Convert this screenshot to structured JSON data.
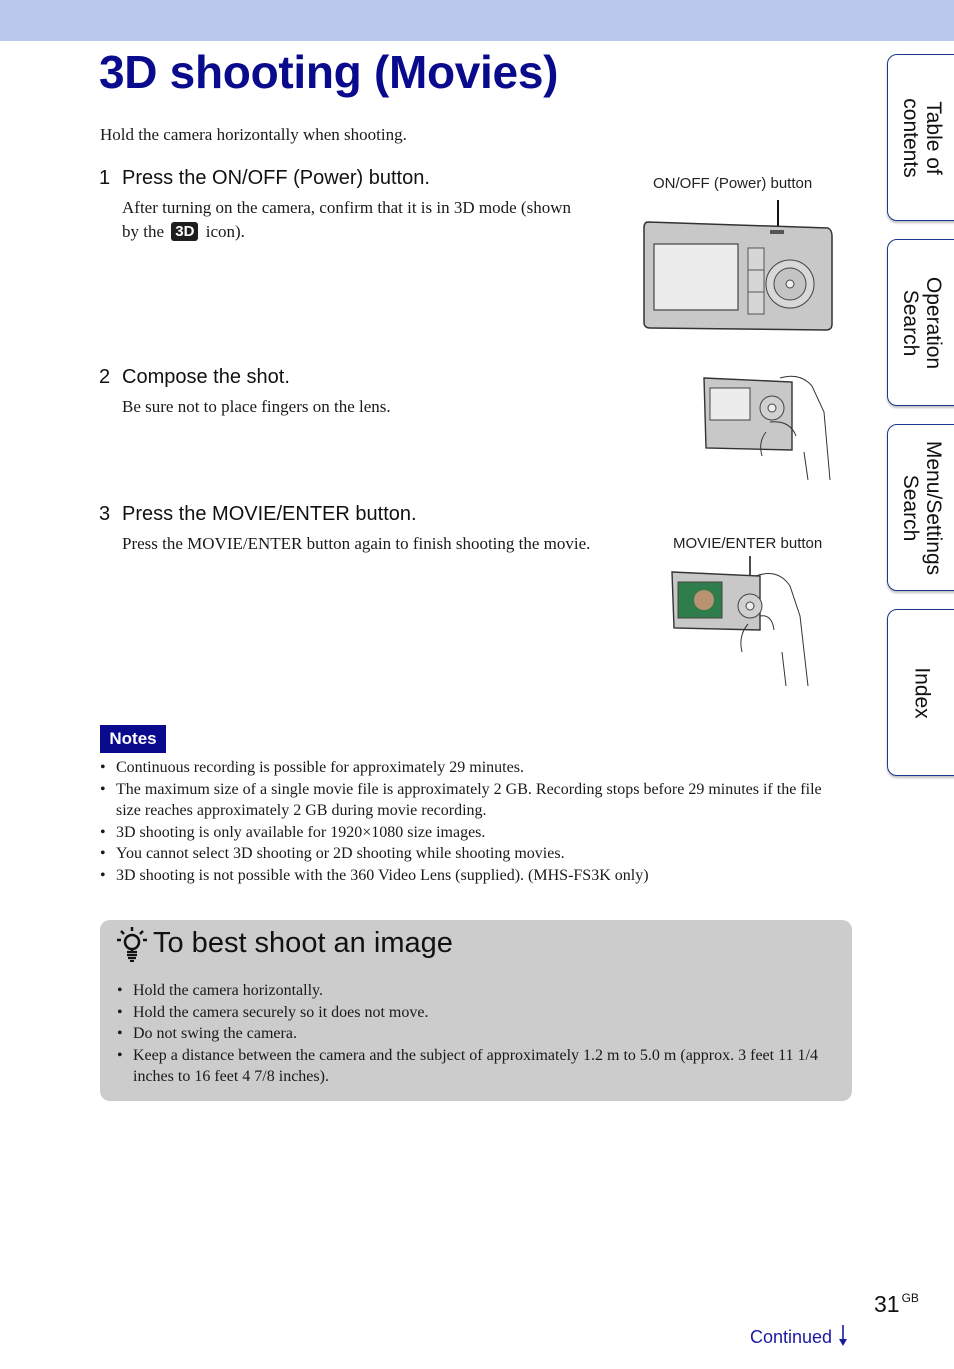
{
  "header": {
    "title": "3D shooting (Movies)"
  },
  "intro": "Hold the camera horizontally when shooting.",
  "steps": [
    {
      "num": "1",
      "heading": "Press the ON/OFF (Power) button.",
      "body_before": "After turning on the camera, confirm that it is in 3D mode (shown by the",
      "icon_label": "3D",
      "body_after": "icon).",
      "figure_label": "ON/OFF (Power) button"
    },
    {
      "num": "2",
      "heading": "Compose the shot.",
      "body": "Be sure not to place fingers on the lens."
    },
    {
      "num": "3",
      "heading": "Press the MOVIE/ENTER button.",
      "body": "Press the MOVIE/ENTER button again to finish shooting the movie.",
      "figure_label": "MOVIE/ENTER button"
    }
  ],
  "notes": {
    "tag": "Notes",
    "items": [
      "Continuous recording is possible for approximately 29 minutes.",
      "The maximum size of a single movie file is approximately 2 GB. Recording stops before 29 minutes if the file size reaches approximately 2 GB during movie recording.",
      "3D shooting is only available for 1920×1080 size images.",
      "You cannot select 3D shooting or 2D shooting while shooting movies.",
      "3D shooting is not possible with the 360 Video Lens (supplied). (MHS-FS3K only)"
    ]
  },
  "tip": {
    "icon": "lightbulb-hint-icon",
    "title": "To best shoot an image",
    "items": [
      "Hold the camera horizontally.",
      "Hold the camera securely so it does not move.",
      "Do not swing the camera.",
      "Keep a distance between the camera and the subject of approximately 1.2 m to 5.0 m (approx. 3 feet 11 1/4 inches to 16 feet 4 7/8 inches)."
    ]
  },
  "side_tabs": [
    {
      "label_line1": "Table of",
      "label_line2": "contents"
    },
    {
      "label_line1": "Operation",
      "label_line2": "Search"
    },
    {
      "label_line1": "Menu/Settings",
      "label_line2": "Search"
    },
    {
      "label_line1": "Index",
      "label_line2": ""
    }
  ],
  "footer": {
    "page_number": "31",
    "page_suffix": "GB",
    "continued": "Continued",
    "continued_icon": "arrow-down-icon"
  },
  "colors": {
    "title": "#0a0a8c",
    "band": "#b9c8ec",
    "notes_tag": "#0a0a8c",
    "tip_box": "#cccccc",
    "tab_border": "#1a3a8c"
  }
}
